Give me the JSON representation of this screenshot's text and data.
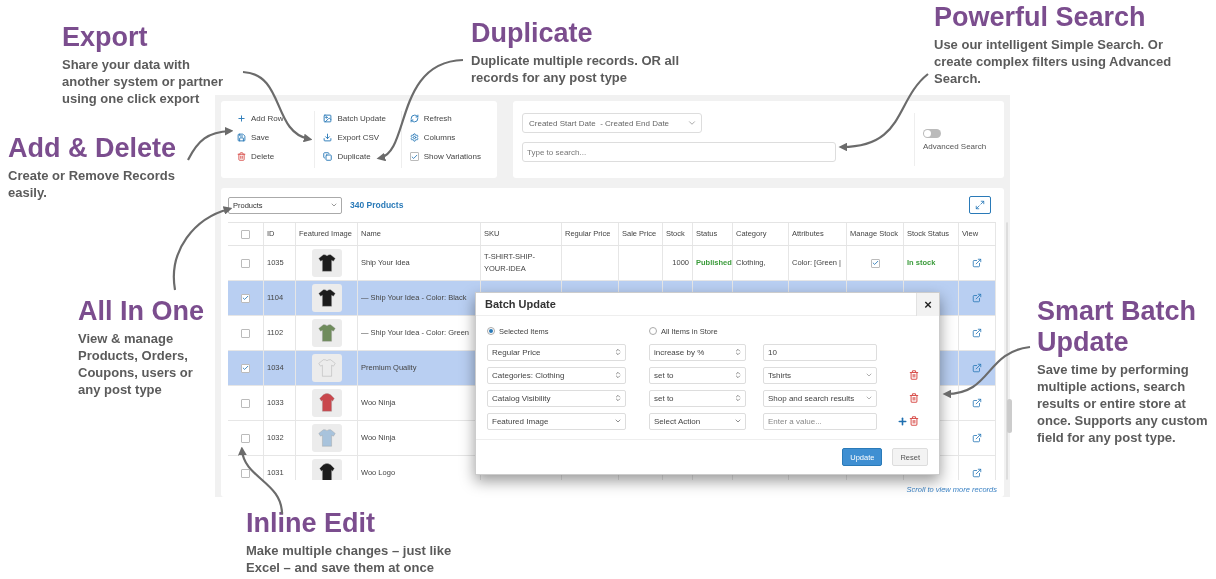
{
  "annotations": [
    {
      "title": "Export",
      "text": "Share your data with another system or partner using one click export"
    },
    {
      "title": "Duplicate",
      "text": "Duplicate multiple records. OR all records for any post type"
    },
    {
      "title": "Powerful Search",
      "text": "Use our intelligent Simple Search. Or create complex filters using Advanced Search."
    },
    {
      "title": "Add & Delete",
      "text": "Create or Remove Records easily."
    },
    {
      "title": "All In One",
      "text": "View & manage Products, Orders, Coupons, users or any post type"
    },
    {
      "title": "Smart Batch Update",
      "text": "Save time by performing multiple actions, search results or entire store at once. Supports any custom field for any post type."
    },
    {
      "title": "Inline Edit",
      "text": "Make multiple changes – just like Excel – and save them at once"
    }
  ],
  "toolbar": {
    "groups": [
      [
        {
          "kind": "action",
          "label": "Add Row"
        },
        {
          "kind": "action",
          "label": "Save"
        },
        {
          "kind": "action",
          "label": "Delete"
        }
      ],
      [
        {
          "kind": "action",
          "label": "Batch Update"
        },
        {
          "kind": "action",
          "label": "Export CSV"
        },
        {
          "kind": "action",
          "label": "Duplicate"
        }
      ],
      [
        {
          "kind": "action",
          "label": "Refresh"
        },
        {
          "kind": "action",
          "label": "Columns"
        },
        {
          "kind": "checkbox",
          "label": "Show Variations",
          "checked": true
        }
      ]
    ]
  },
  "search": {
    "date_range": "Created Start Date  - Created End Date",
    "placeholder": "Type to search...",
    "advanced": {
      "label": "Advanced Search",
      "on": false
    }
  },
  "table": {
    "post_type": "Products",
    "count": "340 Products",
    "select_all_checked": false,
    "columns": [
      "ID",
      "Featured Image",
      "Name",
      "SKU",
      "Regular Price",
      "Sale Price",
      "Stock",
      "Status",
      "Category",
      "Attributes",
      "Manage Stock",
      "Stock Status",
      "View"
    ],
    "rows": [
      {
        "selected": false,
        "id": "1035",
        "thumb": {
          "kind": "tshirt",
          "color": "#1c1c1c"
        },
        "name": "Ship Your Idea",
        "sku": "T-SHIRT-SHIP-YOUR-IDEA",
        "stock": "1000",
        "status": "Published",
        "category": "Clothing,",
        "attributes": "Color: [Green |",
        "manage_stock": true,
        "stock_status": "In stock"
      },
      {
        "selected": true,
        "id": "1104",
        "thumb": {
          "kind": "tshirt",
          "color": "#1c1c1c"
        },
        "name": "— Ship Your Idea - Color: Black"
      },
      {
        "selected": false,
        "id": "1102",
        "thumb": {
          "kind": "tshirt",
          "color": "#6f8c5c"
        },
        "name": "— Ship Your Idea - Color: Green"
      },
      {
        "selected": true,
        "id": "1034",
        "thumb": {
          "kind": "tshirt",
          "color": "#ececec"
        },
        "name": "Premium Quality"
      },
      {
        "selected": false,
        "id": "1033",
        "thumb": {
          "kind": "hoodie",
          "color": "#c9474d"
        },
        "name": "Woo Ninja"
      },
      {
        "selected": false,
        "id": "1032",
        "thumb": {
          "kind": "tshirt",
          "color": "#a8c3dc"
        },
        "name": "Woo Ninja"
      },
      {
        "selected": false,
        "id": "1031",
        "thumb": {
          "kind": "hoodie",
          "color": "#1c1c1c"
        },
        "name": "Woo Logo"
      }
    ],
    "scroll_hint": "Scroll to view more records"
  },
  "dialog": {
    "title": "Batch Update",
    "close": "×",
    "scopes": [
      {
        "label": "Selected Items",
        "selected": true
      },
      {
        "label": "All Items in Store",
        "selected": false
      }
    ],
    "rows": [
      {
        "field": {
          "kind": "stepper",
          "text": "Regular Price"
        },
        "action": {
          "kind": "stepper",
          "text": "increase by %"
        },
        "value": {
          "kind": "input",
          "text": "10"
        },
        "add": false,
        "remove": false
      },
      {
        "field": {
          "kind": "stepper",
          "text": "Categories: Clothing"
        },
        "action": {
          "kind": "stepper",
          "text": "set to"
        },
        "value": {
          "kind": "dropdown",
          "text": "Tshirts"
        },
        "add": false,
        "remove": true
      },
      {
        "field": {
          "kind": "stepper",
          "text": "Catalog Visibility"
        },
        "action": {
          "kind": "stepper",
          "text": "set to"
        },
        "value": {
          "kind": "dropdown",
          "text": "Shop and search results"
        },
        "add": false,
        "remove": true
      },
      {
        "field": {
          "kind": "dropdown",
          "text": "Featured Image"
        },
        "action": {
          "kind": "dropdown",
          "text": "Select Action"
        },
        "value": {
          "kind": "input",
          "placeholder": "Enter a value..."
        },
        "add": true,
        "remove": true
      }
    ],
    "buttons": [
      {
        "label": "Update",
        "kind": "primary"
      },
      {
        "label": "Reset",
        "kind": "default"
      }
    ]
  }
}
